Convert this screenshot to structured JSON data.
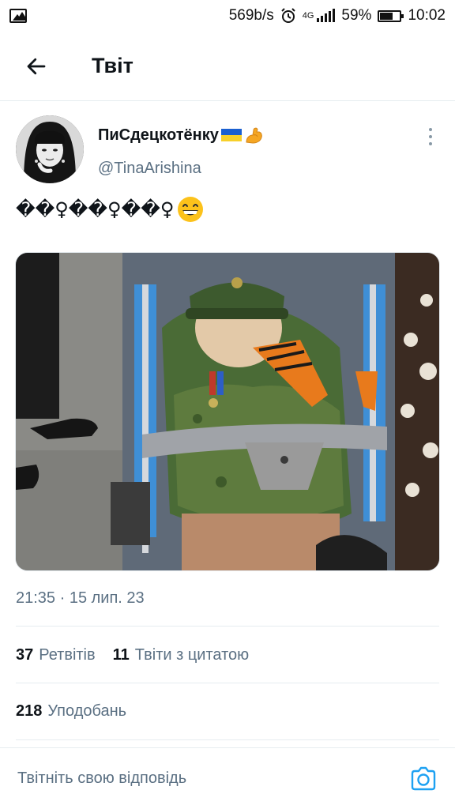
{
  "status_bar": {
    "speed": "569b/s",
    "network": "4G",
    "battery": "59%",
    "battery_level": 0.59,
    "time": "10:02",
    "icons": [
      "gallery-icon",
      "alarm-icon",
      "signal-icon",
      "battery-icon"
    ]
  },
  "header": {
    "title": "Твіт",
    "back_icon": "arrow-left-icon"
  },
  "tweet": {
    "display_name": "ПиСдецкотёнку",
    "name_emojis": [
      "ukraine-flag-icon",
      "flexed-biceps-icon"
    ],
    "handle": "@TinaArishina",
    "text": "��♀��♀��♀",
    "text_emoji": "grinning-face-icon",
    "timestamp": "21:35 · 15 лип. 23",
    "more_icon": "more-vertical-icon"
  },
  "stats": {
    "retweets_count": "37",
    "retweets_label": "Ретвітів",
    "quotes_count": "11",
    "quotes_label": "Твіти з цитатою",
    "likes_count": "218",
    "likes_label": "Уподобань"
  },
  "reply": {
    "placeholder": "Твітніть свою відповідь",
    "camera_icon": "camera-icon"
  },
  "colors": {
    "accent": "#1da1f2",
    "secondary_text": "#5b7083",
    "divider": "#e6ecf0"
  }
}
